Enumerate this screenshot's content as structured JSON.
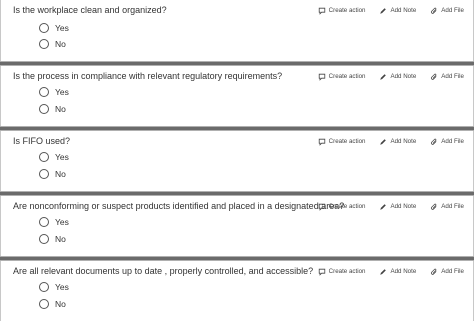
{
  "actions": {
    "create_action": "Create action",
    "add_note": "Add Note",
    "add_file": "Add File"
  },
  "questions": [
    {
      "text": "Is the workplace clean and organized?",
      "options": [
        "Yes",
        "No"
      ]
    },
    {
      "text": "Is the process in compliance with relevant regulatory requirements?",
      "options": [
        "Yes",
        "No"
      ]
    },
    {
      "text": "Is FIFO used?",
      "options": [
        "Yes",
        "No"
      ]
    },
    {
      "text": "Are nonconforming or suspect products identified and placed in a designated area?",
      "options": [
        "Yes",
        "No"
      ]
    },
    {
      "text": "Are all relevant documents up to date , properly controlled, and accessible?",
      "options": [
        "Yes",
        "No"
      ]
    }
  ]
}
